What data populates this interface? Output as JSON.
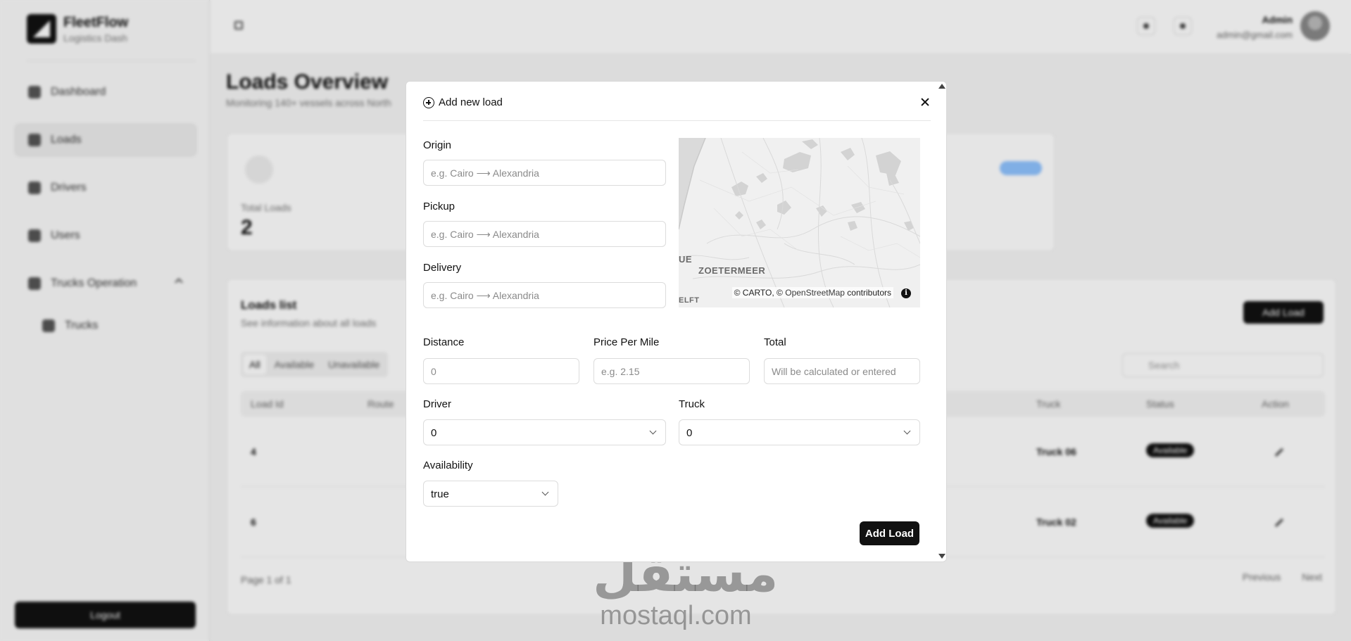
{
  "brand": {
    "name": "FleetFlow",
    "subtitle": "Logistics Dash"
  },
  "sidebar": {
    "items": [
      {
        "label": "Dashboard",
        "icon": "dashboard-icon"
      },
      {
        "label": "Loads",
        "icon": "box-icon"
      },
      {
        "label": "Drivers",
        "icon": "driver-icon"
      },
      {
        "label": "Users",
        "icon": "users-icon"
      },
      {
        "label": "Trucks Operation",
        "icon": "truck-icon"
      },
      {
        "label": "Trucks",
        "icon": "truck-icon"
      }
    ],
    "logout_label": "Logout"
  },
  "topbar": {
    "user_name": "Admin",
    "user_email": "admin@gmail.com"
  },
  "page": {
    "title": "Loads Overview",
    "subtitle": "Monitoring 140+ vessels across North"
  },
  "stats": {
    "label": "Total Loads",
    "value": "2"
  },
  "list": {
    "title": "Loads list",
    "subtitle": "See information about all loads",
    "add_label": "Add Load",
    "filters": [
      "All",
      "Available",
      "Unavailable"
    ],
    "search_placeholder": "Search",
    "headers": [
      "Load Id",
      "Route",
      "Truck",
      "Status",
      "Action"
    ],
    "rows": [
      {
        "id": "4",
        "truck": "Truck 06",
        "status": "Available"
      },
      {
        "id": "6",
        "truck": "Truck 02",
        "status": "Available"
      }
    ],
    "page_info": "Page 1 of 1",
    "prev_label": "Previous",
    "next_label": "Next"
  },
  "modal": {
    "title": "Add new load",
    "origin": {
      "label": "Origin",
      "placeholder": "e.g. Cairo ⟶ Alexandria",
      "value": ""
    },
    "pickup": {
      "label": "Pickup",
      "placeholder": "e.g. Cairo ⟶ Alexandria",
      "value": ""
    },
    "delivery": {
      "label": "Delivery",
      "placeholder": "e.g. Cairo ⟶ Alexandria",
      "value": ""
    },
    "distance": {
      "label": "Distance",
      "placeholder": "0",
      "value": ""
    },
    "price_per_mile": {
      "label": "Price Per Mile",
      "placeholder": "e.g. 2.15",
      "value": ""
    },
    "total": {
      "label": "Total",
      "placeholder": "Will be calculated or entered",
      "value": ""
    },
    "driver": {
      "label": "Driver",
      "value": "0"
    },
    "truck": {
      "label": "Truck",
      "value": "0"
    },
    "availability": {
      "label": "Availability",
      "value": "true"
    },
    "submit_label": "Add Load",
    "map": {
      "labels": [
        "UE",
        "ZOETERMEER",
        "ELFT"
      ],
      "attribution_copy1": "© CARTO, ©",
      "attribution_link": "OpenStreetMap",
      "attribution_tail": "contributors",
      "info_glyph": "i"
    }
  },
  "watermark": {
    "arabic": "مستقل",
    "latin": "mostaql.com"
  }
}
